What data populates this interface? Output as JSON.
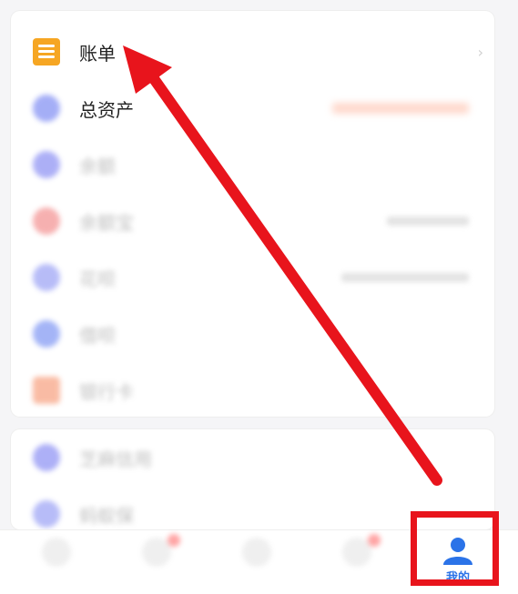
{
  "list": {
    "bill_label": "账单",
    "assets_label": "总资产",
    "balance_label": "余额",
    "yuebao_label": "余额宝",
    "huabei_label": "花呗",
    "jiebei_label": "借呗",
    "bank_card_label": "银行卡"
  },
  "list2": {
    "item1_label": "芝麻信用",
    "item2_label": "蚂蚁保"
  },
  "tabbar": {
    "me_label": "我的"
  },
  "colors": {
    "accent": "#2b73e8",
    "highlight": "#e8141c",
    "bill_icon": "#f6a623"
  }
}
